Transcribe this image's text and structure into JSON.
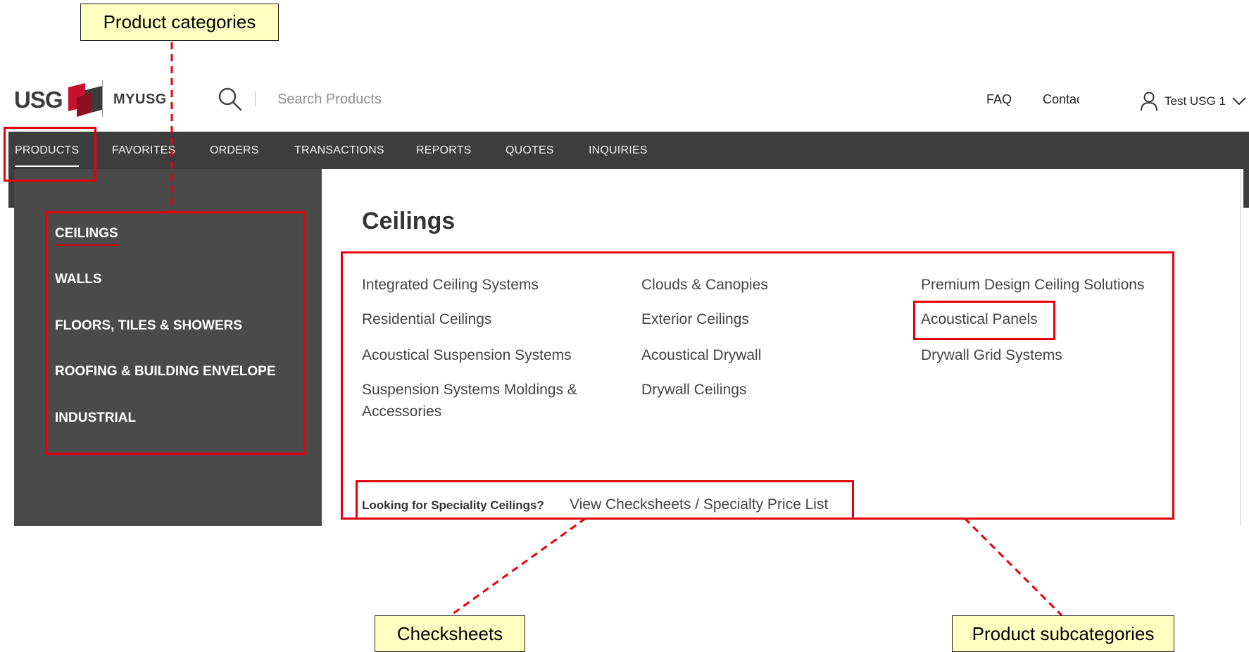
{
  "header": {
    "logo_text": "USG",
    "brand_label": "MYUSG",
    "search_placeholder": "Search Products",
    "faq_label": "FAQ",
    "contact_label": "Contact",
    "user_name": "Test USG 1",
    "icons": {
      "search": "search-icon",
      "user": "user-icon",
      "chevron": "chevron-down-icon"
    }
  },
  "nav": {
    "items": [
      {
        "label": "PRODUCTS",
        "active": true
      },
      {
        "label": "FAVORITES"
      },
      {
        "label": "ORDERS"
      },
      {
        "label": "TRANSACTIONS"
      },
      {
        "label": "REPORTS"
      },
      {
        "label": "QUOTES"
      },
      {
        "label": "INQUIRIES"
      }
    ]
  },
  "menu": {
    "categories": [
      {
        "label": "CEILINGS",
        "active": true
      },
      {
        "label": "WALLS"
      },
      {
        "label": "FLOORS, TILES & SHOWERS"
      },
      {
        "label": "ROOFING & BUILDING ENVELOPE"
      },
      {
        "label": "INDUSTRIAL"
      }
    ],
    "panel_title": "Ceilings",
    "subcategories": [
      [
        "Integrated Ceiling Systems",
        "Residential Ceilings",
        "Acoustical Suspension Systems",
        "Suspension Systems Moldings & Accessories"
      ],
      [
        "Clouds & Canopies",
        "Exterior Ceilings",
        "Acoustical Drywall",
        "Drywall Ceilings"
      ],
      [
        "Premium Design Ceiling Solutions",
        "Acoustical Panels",
        "Drywall Grid Systems"
      ]
    ],
    "specialty_question": "Looking for Speciality Ceilings?",
    "specialty_link": "View Checksheets / Specialty Price List"
  },
  "annotations": {
    "product_categories": "Product categories",
    "checksheets": "Checksheets",
    "product_subcategories": "Product subcategories"
  },
  "colors": {
    "nav_bg": "#3d3d3d",
    "menu_left_bg": "#4a4a4a",
    "brand_red": "#d0021b",
    "annotation_red": "#e8000b",
    "callout_bg": "#ffffc2"
  }
}
